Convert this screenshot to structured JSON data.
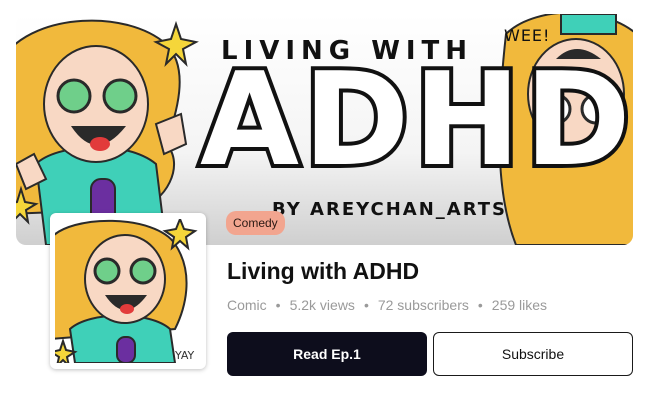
{
  "banner": {
    "line_top": "LIVING WITH",
    "line_big": "ADHD",
    "credit": "BY AREYCHAN_ARTS",
    "exclaim": "WEE!",
    "illustration": "cartoon-girl-artwork"
  },
  "genre_badge": "Comedy",
  "thumbnail": {
    "illustration": "cartoon-girl-artwork",
    "corner_text": "YAY"
  },
  "series": {
    "title": "Living with ADHD",
    "stats": [
      "Comic",
      "5.2k views",
      "72 subscribers",
      "259 likes"
    ],
    "separator": "•"
  },
  "buttons": {
    "read_label": "Read Ep.1",
    "subscribe_label": "Subscribe"
  },
  "colors": {
    "badge": "#f2a58f",
    "read_button": "#0d0d1c",
    "hair": "#f1b93c",
    "shirt": "#3fd0b8"
  }
}
